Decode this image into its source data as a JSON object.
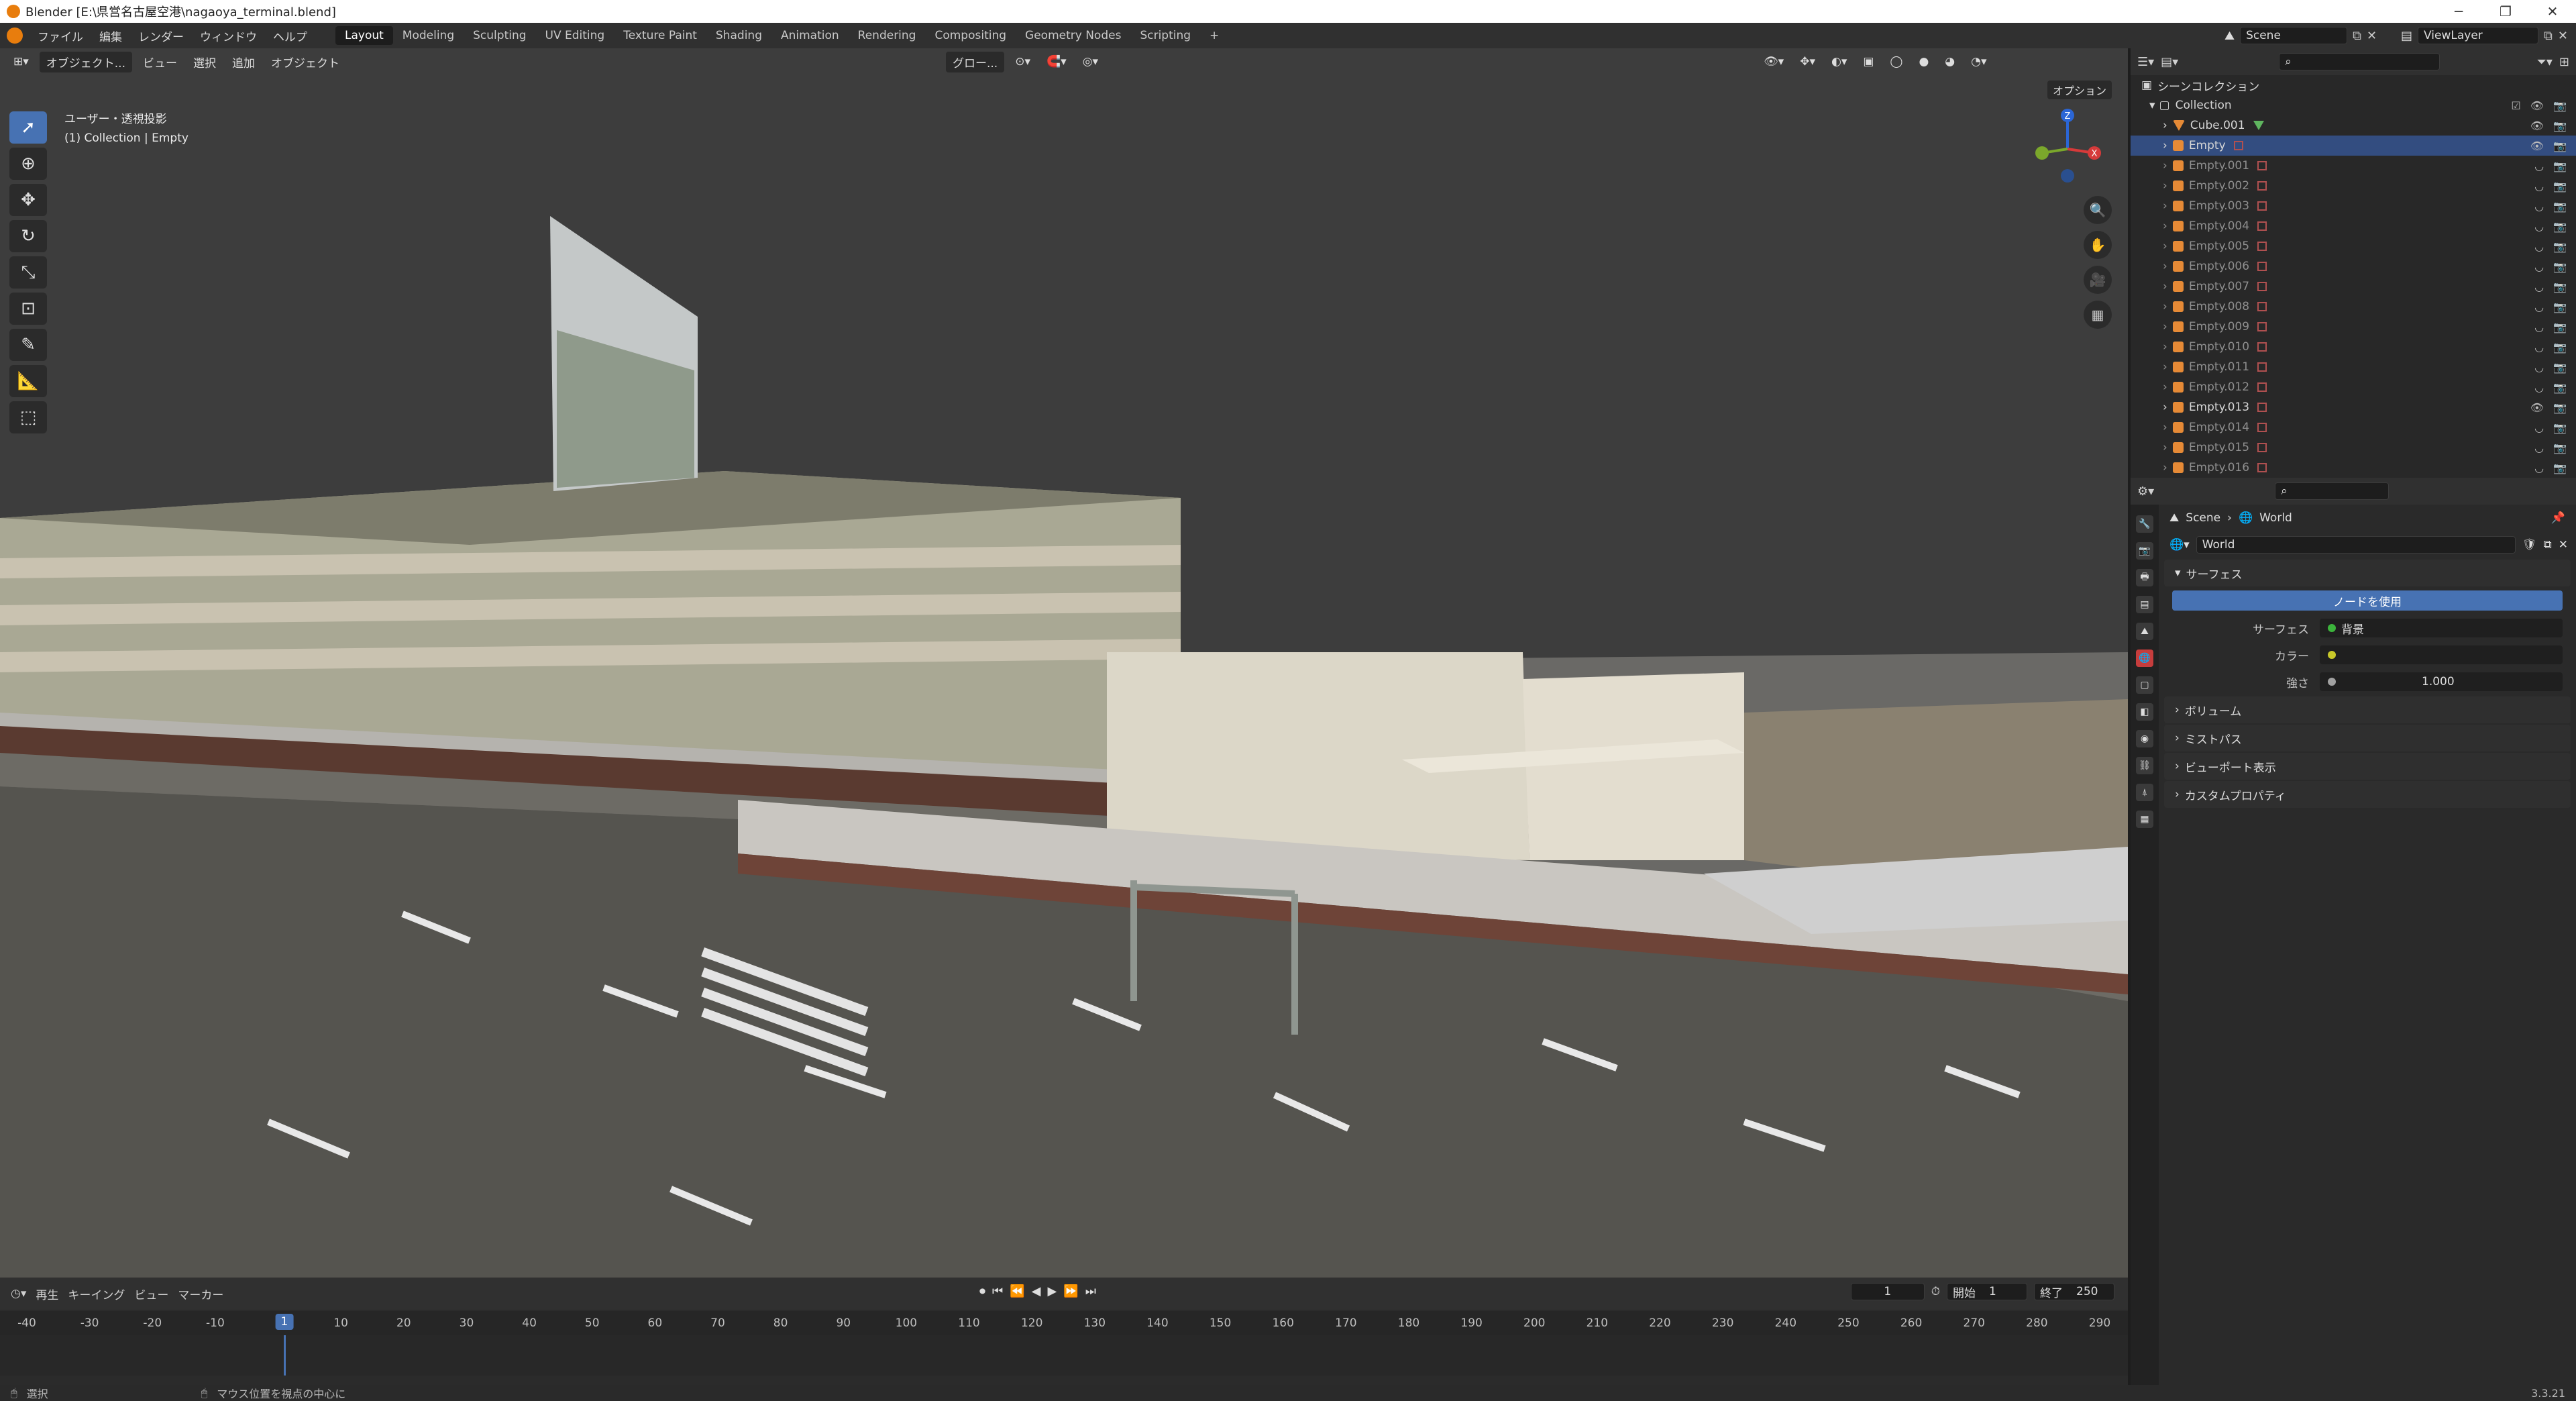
{
  "window": {
    "title": "Blender [E:\\県営名古屋空港\\nagaoya_terminal.blend]",
    "min_icon": "minimize-icon",
    "max_icon": "maximize-icon",
    "close_icon": "close-icon"
  },
  "topbar": {
    "menus": [
      "ファイル",
      "編集",
      "レンダー",
      "ウィンドウ",
      "ヘルプ"
    ],
    "workspaces": [
      "Layout",
      "Modeling",
      "Sculpting",
      "UV Editing",
      "Texture Paint",
      "Shading",
      "Animation",
      "Rendering",
      "Compositing",
      "Geometry Nodes",
      "Scripting"
    ],
    "active_workspace": "Layout",
    "add_label": "+",
    "scene": "Scene",
    "view_layer": "ViewLayer"
  },
  "viewport": {
    "mode": "オブジェクト...",
    "menus": [
      "ビュー",
      "選択",
      "追加",
      "オブジェクト"
    ],
    "transform": "グロー...",
    "options": "オプション",
    "info_line1": "ユーザー・透視投影",
    "info_line2": "(1) Collection | Empty",
    "gizmo_labels": {
      "z": "Z",
      "x": "X"
    }
  },
  "timeline": {
    "menus": [
      "再生",
      "キーイング",
      "ビュー",
      "マーカー"
    ],
    "ticks": [
      -40,
      -30,
      -20,
      -10,
      1,
      10,
      20,
      30,
      40,
      50,
      60,
      70,
      80,
      90,
      100,
      110,
      120,
      130,
      140,
      150,
      160,
      170,
      180,
      190,
      200,
      210,
      220,
      230,
      240,
      250,
      260,
      270,
      280,
      290
    ],
    "current_frame": "1",
    "frame_display": "1",
    "start_label": "開始",
    "start_value": "1",
    "end_label": "終了",
    "end_value": "250"
  },
  "statusbar": {
    "select": "選択",
    "center_view": "マウス位置を視点の中心に",
    "version": "3.3.21"
  },
  "outliner": {
    "scene_collection": "シーンコレクション",
    "collection": "Collection",
    "items": [
      {
        "name": "Cube.001",
        "type": "mesh",
        "visible": true,
        "selected": false
      },
      {
        "name": "Empty",
        "type": "empty",
        "visible": true,
        "selected": true
      },
      {
        "name": "Empty.001",
        "type": "empty",
        "visible": false,
        "selected": false
      },
      {
        "name": "Empty.002",
        "type": "empty",
        "visible": false,
        "selected": false
      },
      {
        "name": "Empty.003",
        "type": "empty",
        "visible": false,
        "selected": false
      },
      {
        "name": "Empty.004",
        "type": "empty",
        "visible": false,
        "selected": false
      },
      {
        "name": "Empty.005",
        "type": "empty",
        "visible": false,
        "selected": false
      },
      {
        "name": "Empty.006",
        "type": "empty",
        "visible": false,
        "selected": false
      },
      {
        "name": "Empty.007",
        "type": "empty",
        "visible": false,
        "selected": false
      },
      {
        "name": "Empty.008",
        "type": "empty",
        "visible": false,
        "selected": false
      },
      {
        "name": "Empty.009",
        "type": "empty",
        "visible": false,
        "selected": false
      },
      {
        "name": "Empty.010",
        "type": "empty",
        "visible": false,
        "selected": false
      },
      {
        "name": "Empty.011",
        "type": "empty",
        "visible": false,
        "selected": false
      },
      {
        "name": "Empty.012",
        "type": "empty",
        "visible": false,
        "selected": false
      },
      {
        "name": "Empty.013",
        "type": "empty",
        "visible": true,
        "selected": false
      },
      {
        "name": "Empty.014",
        "type": "empty",
        "visible": false,
        "selected": false
      },
      {
        "name": "Empty.015",
        "type": "empty",
        "visible": false,
        "selected": false
      },
      {
        "name": "Empty.016",
        "type": "empty",
        "visible": false,
        "selected": false
      }
    ]
  },
  "properties": {
    "breadcrumb_scene": "Scene",
    "breadcrumb_world": "World",
    "world_name": "World",
    "surface_section": "サーフェス",
    "use_nodes": "ノードを使用",
    "surface_label": "サーフェス",
    "surface_value": "背景",
    "color_label": "カラー",
    "strength_label": "強さ",
    "strength_value": "1.000",
    "collapsed_sections": [
      "ボリューム",
      "ミストパス",
      "ビューポート表示",
      "カスタムプロパティ"
    ]
  },
  "colors": {
    "accent": "#4772b3",
    "selection": "#334d80",
    "blender_orange": "#e87d0d",
    "world_tab": "#c63d3d"
  }
}
